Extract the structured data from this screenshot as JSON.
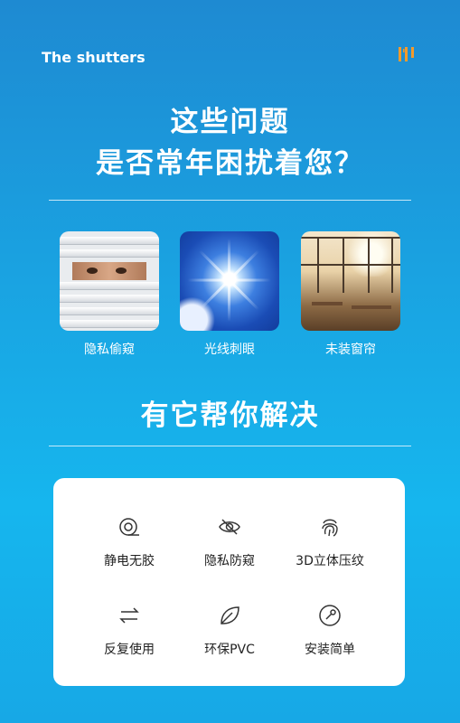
{
  "header": {
    "brand": "The shutters",
    "logo_icon": "shutter-logo-icon",
    "logo_color": "#f39a2b"
  },
  "headline": {
    "line1": "这些问题",
    "line2": "是否常年困扰着您？"
  },
  "problems": [
    {
      "label": "隐私偷窥",
      "image": "peeking-through-blinds"
    },
    {
      "label": "光线刺眼",
      "image": "bright-sun"
    },
    {
      "label": "未装窗帘",
      "image": "sunlit-room"
    }
  ],
  "solution_title": "有它帮你解决",
  "features": [
    {
      "label": "静电无胶",
      "icon": "tape-roll-icon"
    },
    {
      "label": "隐私防窥",
      "icon": "eye-slash-icon"
    },
    {
      "label": "3D立体压纹",
      "icon": "fingerprint-icon"
    },
    {
      "label": "反复使用",
      "icon": "swap-arrows-icon"
    },
    {
      "label": "环保PVC",
      "icon": "leaf-icon"
    },
    {
      "label": "安装简单",
      "icon": "wrench-circle-icon"
    }
  ],
  "colors": {
    "bg_top": "#1e8ad2",
    "bg_bottom": "#16b6ee",
    "card": "#ffffff"
  }
}
